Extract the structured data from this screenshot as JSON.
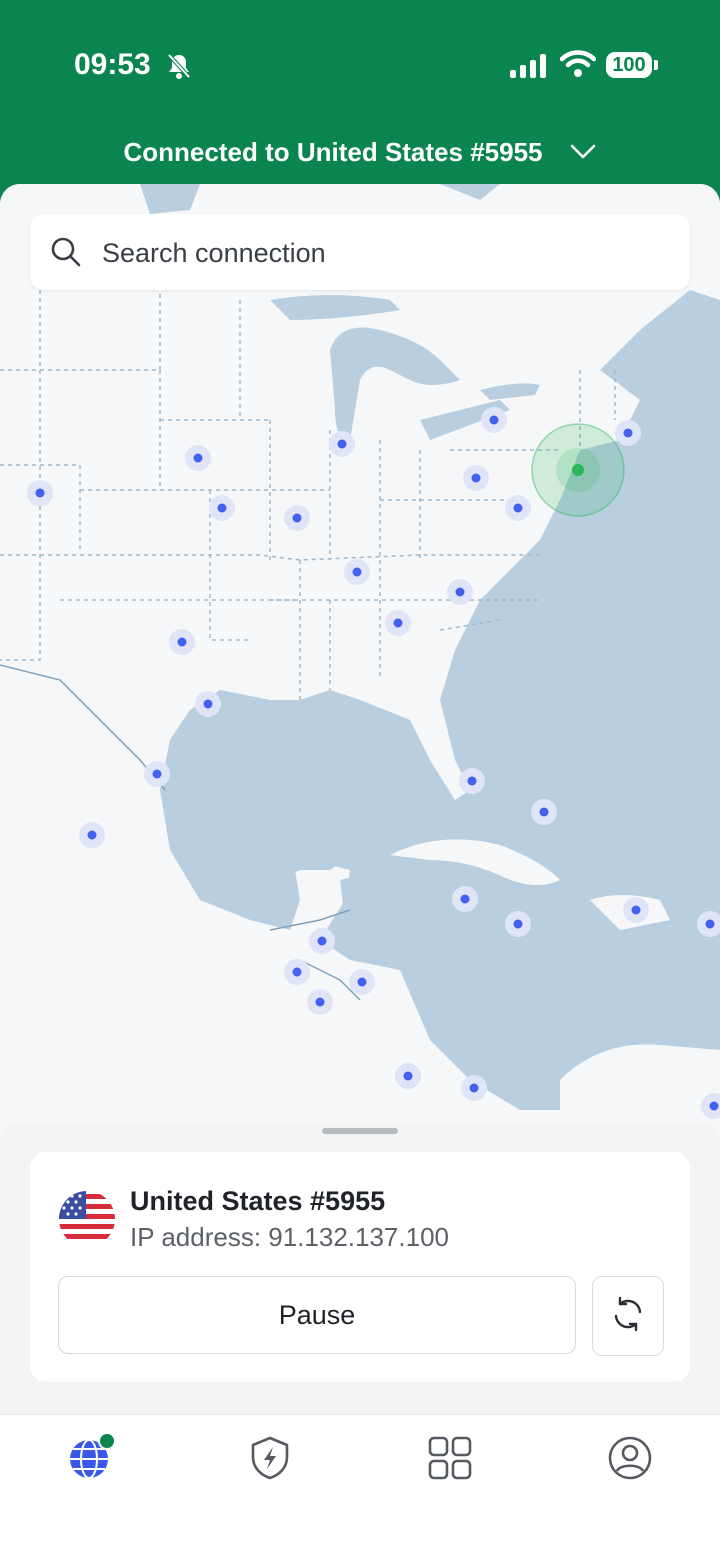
{
  "status_bar": {
    "time": "09:53",
    "battery": "100"
  },
  "header": {
    "connected_label": "Connected to United States #5955"
  },
  "search": {
    "placeholder": "Search connection"
  },
  "connection_card": {
    "server_name": "United States #5955",
    "ip_address": "IP address: 91.132.137.100",
    "pause_label": "Pause"
  },
  "tabs": [
    {
      "icon": "globe-icon",
      "active": true
    },
    {
      "icon": "shield-bolt-icon",
      "active": false
    },
    {
      "icon": "grid-icon",
      "active": false
    },
    {
      "icon": "profile-icon",
      "active": false
    }
  ],
  "colors": {
    "brand_green": "#0b8550",
    "marker_blue": "#4361ee",
    "connected_green": "#2fb55a",
    "water": "#b9cfe0",
    "land": "#f6f7f8"
  },
  "map_markers": [
    {
      "name": "marker-1"
    },
    {
      "name": "marker-2"
    }
  ]
}
